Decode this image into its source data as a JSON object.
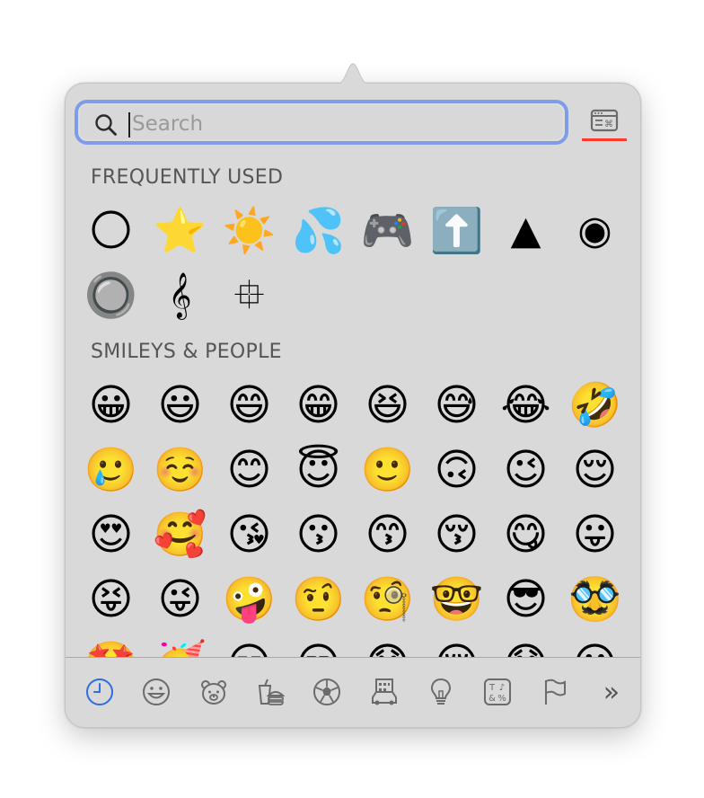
{
  "search": {
    "placeholder": "Search",
    "value": ""
  },
  "sections": [
    {
      "title": "FREQUENTLY USED",
      "items": [
        {
          "char": "🌕",
          "type": "emoji"
        },
        {
          "char": "⭐",
          "type": "emoji"
        },
        {
          "char": "☀️",
          "type": "emoji"
        },
        {
          "char": "💦",
          "type": "emoji"
        },
        {
          "char": "🎮",
          "type": "emoji"
        },
        {
          "char": "⬆️",
          "type": "emoji"
        },
        {
          "char": "▲",
          "type": "symbol"
        },
        {
          "char": "◉",
          "type": "symbol"
        },
        {
          "char": "🔘",
          "type": "emoji"
        },
        {
          "char": "𝄞",
          "type": "symbol"
        },
        {
          "char": "⯐",
          "type": "symbol"
        }
      ]
    },
    {
      "title": "SMILEYS & PEOPLE",
      "items": [
        {
          "char": "😀",
          "type": "emoji"
        },
        {
          "char": "😃",
          "type": "emoji"
        },
        {
          "char": "😄",
          "type": "emoji"
        },
        {
          "char": "😁",
          "type": "emoji"
        },
        {
          "char": "😆",
          "type": "emoji"
        },
        {
          "char": "😅",
          "type": "emoji"
        },
        {
          "char": "😂",
          "type": "emoji"
        },
        {
          "char": "🤣",
          "type": "emoji"
        },
        {
          "char": "🥲",
          "type": "emoji"
        },
        {
          "char": "☺️",
          "type": "emoji"
        },
        {
          "char": "😊",
          "type": "emoji"
        },
        {
          "char": "😇",
          "type": "emoji"
        },
        {
          "char": "🙂",
          "type": "emoji"
        },
        {
          "char": "🙃",
          "type": "emoji"
        },
        {
          "char": "😉",
          "type": "emoji"
        },
        {
          "char": "😌",
          "type": "emoji"
        },
        {
          "char": "😍",
          "type": "emoji"
        },
        {
          "char": "🥰",
          "type": "emoji"
        },
        {
          "char": "😘",
          "type": "emoji"
        },
        {
          "char": "😗",
          "type": "emoji"
        },
        {
          "char": "😙",
          "type": "emoji"
        },
        {
          "char": "😚",
          "type": "emoji"
        },
        {
          "char": "😋",
          "type": "emoji"
        },
        {
          "char": "😛",
          "type": "emoji"
        },
        {
          "char": "😝",
          "type": "emoji"
        },
        {
          "char": "😜",
          "type": "emoji"
        },
        {
          "char": "🤪",
          "type": "emoji"
        },
        {
          "char": "🤨",
          "type": "emoji"
        },
        {
          "char": "🧐",
          "type": "emoji"
        },
        {
          "char": "🤓",
          "type": "emoji"
        },
        {
          "char": "😎",
          "type": "emoji"
        },
        {
          "char": "🥸",
          "type": "emoji"
        },
        {
          "char": "🤩",
          "type": "emoji"
        },
        {
          "char": "🥳",
          "type": "emoji"
        },
        {
          "char": "😏",
          "type": "emoji"
        },
        {
          "char": "😒",
          "type": "emoji"
        },
        {
          "char": "😞",
          "type": "emoji"
        },
        {
          "char": "😔",
          "type": "emoji"
        },
        {
          "char": "😟",
          "type": "emoji"
        },
        {
          "char": "😕",
          "type": "emoji"
        }
      ]
    }
  ],
  "categories": [
    {
      "name": "recent",
      "icon": "clock-icon",
      "active": true
    },
    {
      "name": "smileys-people",
      "icon": "smiley-icon",
      "active": false
    },
    {
      "name": "animals-nature",
      "icon": "bear-icon",
      "active": false
    },
    {
      "name": "food-drink",
      "icon": "food-icon",
      "active": false
    },
    {
      "name": "activity",
      "icon": "soccer-ball-icon",
      "active": false
    },
    {
      "name": "travel-places",
      "icon": "car-building-icon",
      "active": false
    },
    {
      "name": "objects",
      "icon": "lightbulb-icon",
      "active": false
    },
    {
      "name": "symbols",
      "icon": "symbols-icon",
      "active": false
    },
    {
      "name": "flags",
      "icon": "flag-icon",
      "active": false
    },
    {
      "name": "more",
      "icon": "chevron-double-right-icon",
      "active": false
    }
  ],
  "colors": {
    "panel": "#d9d9d9",
    "focus_ring": "#7f9ce8",
    "accent_active": "#2f6de0",
    "icon_gray": "#6b6b6b",
    "underline_red": "#ff3b30"
  },
  "more_glyph": "»"
}
